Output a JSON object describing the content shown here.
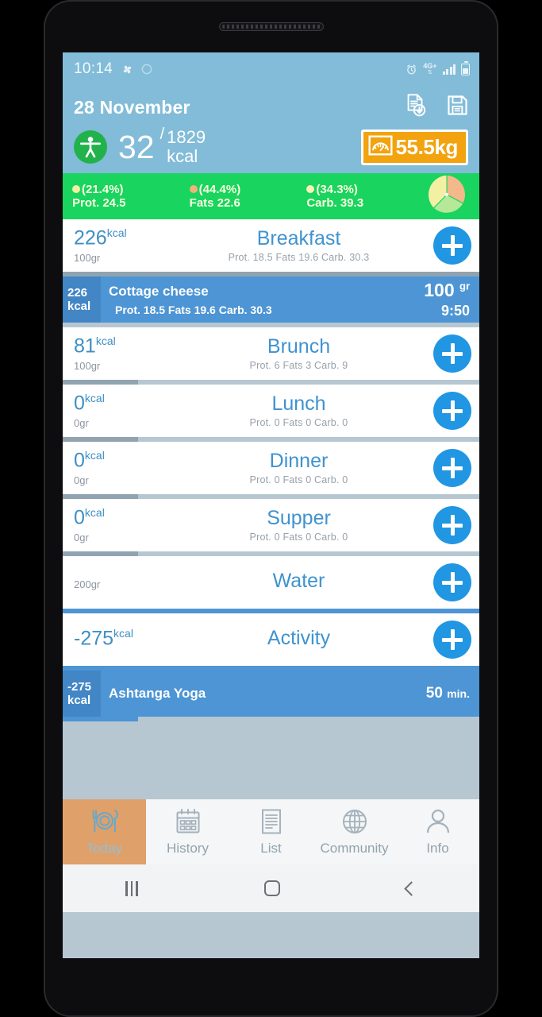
{
  "status_bar": {
    "time": "10:14",
    "network": "4G+",
    "icons": [
      "pinwheel-icon",
      "circle-icon",
      "alarm-icon",
      "network-4gplus-icon",
      "signal-bars-icon",
      "battery-icon"
    ]
  },
  "header": {
    "date": "28 November",
    "import_label": "import-icon",
    "save_label": "save-icon",
    "calories_consumed": "32",
    "calories_separator": "/",
    "calories_goal": "1829",
    "calories_unit": "kcal",
    "weight": "55.5kg"
  },
  "macros": [
    {
      "name": "Prot.",
      "percent": "(21.4%)",
      "value": "24.5",
      "label": "Prot. 24.5",
      "color": "#f5f0a0"
    },
    {
      "name": "Fats",
      "percent": "(44.4%)",
      "value": "22.6",
      "label": "Fats 22.6",
      "color": "#f2b27a"
    },
    {
      "name": "Carb.",
      "percent": "(34.3%)",
      "value": "39.3",
      "label": "Carb. 39.3",
      "color": "#f8f3b8"
    }
  ],
  "chart_data": {
    "type": "pie",
    "title": "Macronutrient distribution",
    "categories": [
      "Prot.",
      "Fats",
      "Carb."
    ],
    "values": [
      21.4,
      44.4,
      34.3
    ],
    "grams": [
      24.5,
      22.6,
      39.3
    ],
    "colors": [
      "#f5f0a0",
      "#f2b27a",
      "#b6e89a"
    ],
    "legend_position": "left",
    "labels": [
      "(21.4%) Prot. 24.5",
      "(44.4%) Fats 22.6",
      "(34.3%) Carb. 39.3"
    ]
  },
  "meals": [
    {
      "title": "Breakfast",
      "kcal": "226",
      "kcal_unit": "kcal",
      "grams": "100gr",
      "macros": "Prot. 18.5  Fats 19.6  Carb. 30.3",
      "progress_pct": 100,
      "entries": [
        {
          "kcal": "226",
          "kcal_unit": "kcal",
          "name": "Cottage cheese",
          "macros": "Prot. 18.5  Fats 19.6  Carb. 30.3",
          "qty": "100",
          "qty_unit": "gr",
          "time": "9:50"
        }
      ]
    },
    {
      "title": "Brunch",
      "kcal": "81",
      "kcal_unit": "kcal",
      "grams": "100gr",
      "macros": "Prot. 6  Fats 3  Carb. 9",
      "progress_pct": 18,
      "entries": []
    },
    {
      "title": "Lunch",
      "kcal": "0",
      "kcal_unit": "kcal",
      "grams": "0gr",
      "macros": "Prot. 0  Fats 0  Carb. 0",
      "progress_pct": 18,
      "entries": []
    },
    {
      "title": "Dinner",
      "kcal": "0",
      "kcal_unit": "kcal",
      "grams": "0gr",
      "macros": "Prot. 0  Fats 0  Carb. 0",
      "progress_pct": 18,
      "entries": []
    },
    {
      "title": "Supper",
      "kcal": "0",
      "kcal_unit": "kcal",
      "grams": "0gr",
      "macros": "Prot. 0  Fats 0  Carb. 0",
      "progress_pct": 18,
      "entries": []
    },
    {
      "title": "Water",
      "kcal": "",
      "kcal_unit": "",
      "grams": "200gr",
      "macros": "",
      "progress_pct": 0,
      "entries": []
    },
    {
      "title": "Activity",
      "kcal": "-275",
      "kcal_unit": "kcal",
      "grams": "",
      "macros": "",
      "progress_pct": 0,
      "entries": [
        {
          "kcal": "-275",
          "kcal_unit": "kcal",
          "name": "Ashtanga Yoga",
          "macros": "",
          "duration": "50",
          "duration_unit": "min."
        }
      ]
    }
  ],
  "tabs": [
    {
      "label": "Today",
      "icon": "plate-cutlery-icon",
      "active": true
    },
    {
      "label": "History",
      "icon": "calendar-icon",
      "active": false
    },
    {
      "label": "List",
      "icon": "list-document-icon",
      "active": false
    },
    {
      "label": "Community",
      "icon": "globe-icon",
      "active": false
    },
    {
      "label": "Info",
      "icon": "person-icon",
      "active": false
    }
  ],
  "android_nav": {
    "recents": "recents-icon",
    "home": "home-icon",
    "back": "back-icon"
  }
}
